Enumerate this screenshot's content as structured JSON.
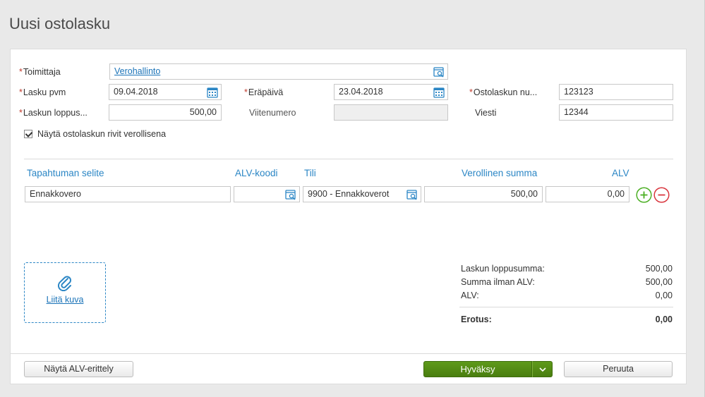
{
  "page": {
    "title": "Uusi ostolasku"
  },
  "form": {
    "supplier": {
      "label": "Toimittaja",
      "value": "Verohallinto"
    },
    "invoice_date": {
      "label": "Lasku pvm",
      "value": "09.04.2018"
    },
    "due_date": {
      "label": "Eräpäivä",
      "value": "23.04.2018"
    },
    "invoice_number": {
      "label": "Ostolaskun nu...",
      "value": "123123"
    },
    "total": {
      "label": "Laskun loppus...",
      "value": "500,00"
    },
    "reference": {
      "label": "Viitenumero",
      "value": ""
    },
    "message": {
      "label": "Viesti",
      "value": "12344"
    },
    "show_with_tax": {
      "label": "Näytä ostolaskun rivit verollisena",
      "checked": true
    },
    "required_mark": "*"
  },
  "rows": {
    "headers": {
      "description": "Tapahtuman selite",
      "vat_code": "ALV-koodi",
      "account": "Tili",
      "gross_amount": "Verollinen summa",
      "vat": "ALV"
    },
    "items": [
      {
        "description": "Ennakkovero",
        "vat_code": "",
        "account": "9900 - Ennakkoverot",
        "gross_amount": "500,00",
        "vat": "0,00"
      }
    ]
  },
  "attachment": {
    "label": "Liitä kuva"
  },
  "summary": {
    "total_label": "Laskun loppusumma:",
    "total_value": "500,00",
    "net_label": "Summa ilman ALV:",
    "net_value": "500,00",
    "vat_label": "ALV:",
    "vat_value": "0,00",
    "difference_label": "Erotus:",
    "difference_value": "0,00"
  },
  "footer": {
    "vat_breakdown_label": "Näytä ALV-erittely",
    "approve_label": "Hyväksy",
    "cancel_label": "Peruuta"
  },
  "colors": {
    "accent": "#2b86c5",
    "approve": "#4f8514",
    "required": "#c0392b",
    "add": "#4caf24",
    "remove": "#d9363e"
  },
  "icons": [
    "search-icon",
    "calendar-icon",
    "add-circle-icon",
    "remove-circle-icon",
    "paperclip-icon",
    "chevron-down-icon",
    "check-icon"
  ]
}
